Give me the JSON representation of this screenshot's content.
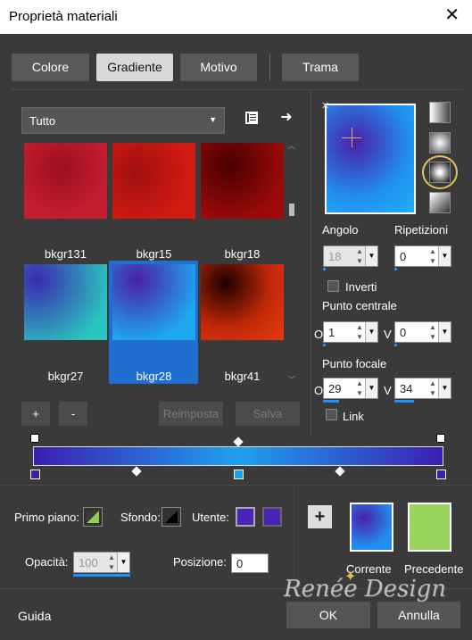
{
  "window": {
    "title": "Proprietà materiali",
    "close_glyph": "✕"
  },
  "tabs": [
    {
      "label": "Colore"
    },
    {
      "label": "Gradiente"
    },
    {
      "label": "Motivo"
    },
    {
      "label": "Trama"
    }
  ],
  "gallery": {
    "category": "Tutto",
    "items": [
      {
        "label": "bkgr131"
      },
      {
        "label": "bkgr15"
      },
      {
        "label": "bkgr18"
      },
      {
        "label": "bkgr27"
      },
      {
        "label": "bkgr28"
      },
      {
        "label": "bkgr41"
      }
    ],
    "selected": "bkgr28"
  },
  "buttons": {
    "add": "+",
    "remove": "-",
    "reset": "Reimposta",
    "save": "Salva"
  },
  "preview": {
    "angle_label": "Angolo",
    "angle_value": "18",
    "repeats_label": "Ripetizioni",
    "repeats_value": "0",
    "invert_label": "Inverti",
    "center_label": "Punto centrale",
    "center_h_label": "O",
    "center_h": "1",
    "center_v_label": "V",
    "center_v": "0",
    "focal_label": "Punto focale",
    "focal_h_label": "O",
    "focal_h": "29",
    "focal_v_label": "V",
    "focal_v": "34",
    "link_label": "Link"
  },
  "colors": {
    "foreground_label": "Primo piano:",
    "background_label": "Sfondo:",
    "user_label": "Utente:",
    "opacity_label": "Opacità:",
    "opacity_value": "100",
    "position_label": "Posizione:",
    "position_value": "0",
    "current_label": "Corrente",
    "previous_label": "Precedente",
    "user_color": "#4a24b4",
    "previous_color": "#98d45e"
  },
  "footer": {
    "help": "Guida",
    "ok": "OK",
    "cancel": "Annulla"
  },
  "watermark": "Renée Design"
}
